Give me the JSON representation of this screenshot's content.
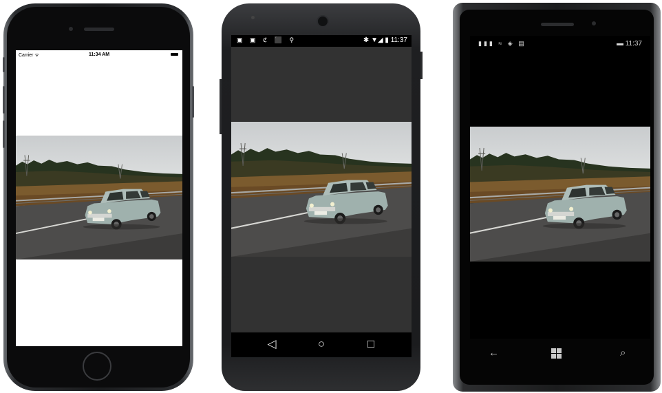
{
  "iphone": {
    "carrier": "Carrier ᯤ",
    "time": "11:34 AM"
  },
  "android": {
    "status_icons": "▣ ▣ ℭ ⬛ ⚲",
    "status_right": "✱ ▼◢ ▮ 11:37",
    "nav": {
      "back": "◁",
      "home": "○",
      "recents": "□"
    }
  },
  "winphone": {
    "status_left": "▮▮▮ ≈ ◈ ▤",
    "status_right": "▬ 11:37",
    "nav": {
      "back": "←",
      "search": "⌕"
    }
  },
  "photo_description_icon": "car-photo"
}
